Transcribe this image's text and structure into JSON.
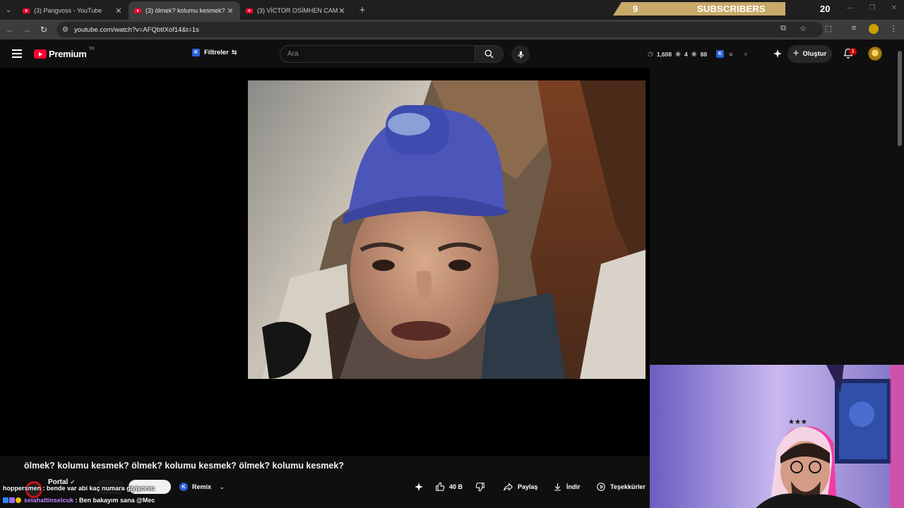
{
  "browser": {
    "tabs": [
      {
        "title": "(3) Pangvoss - YouTube",
        "active": false
      },
      {
        "title": "(3) ölmek? kolumu kesmek? ölmek?",
        "active": true
      },
      {
        "title": "(3) VİCTOR OSİMHEN CAMİ | M",
        "active": false
      }
    ],
    "url": "youtube.com/watch?v=AFQbtIXof14&t=1s"
  },
  "subscriber_goal": {
    "current": "9",
    "label": "SUBSCRIBERS",
    "target": "20",
    "progress_fraction": 0.45,
    "bar_color": "#c9a96a"
  },
  "youtube": {
    "logo_text": "Premium",
    "logo_region": "TR",
    "filters_label": "Filtreler",
    "search_placeholder": "Ara",
    "stats": {
      "coins": "1,608",
      "views_a": "4",
      "views_b": "88"
    },
    "create_label": "Oluştur",
    "notification_count": "3"
  },
  "video": {
    "title": "ölmek? kolumu kesmek? ölmek? kolumu kesmek? ölmek? kolumu kesmek?",
    "channel_name": "Portal",
    "remix_label": "Remix",
    "likes": "40 B",
    "share_label": "Paylaş",
    "download_label": "İndir",
    "thanks_label": "Teşekkürler"
  },
  "chat": [
    {
      "user": "hoppersmen",
      "message": "bende var abi kaç numara giyiyorsu"
    },
    {
      "user": "selahattinselcuk",
      "message": "Ben bakayım sana @Mec"
    }
  ],
  "colors": {
    "brand_red": "#ff0033",
    "chat_user_color": "#c58cff"
  }
}
